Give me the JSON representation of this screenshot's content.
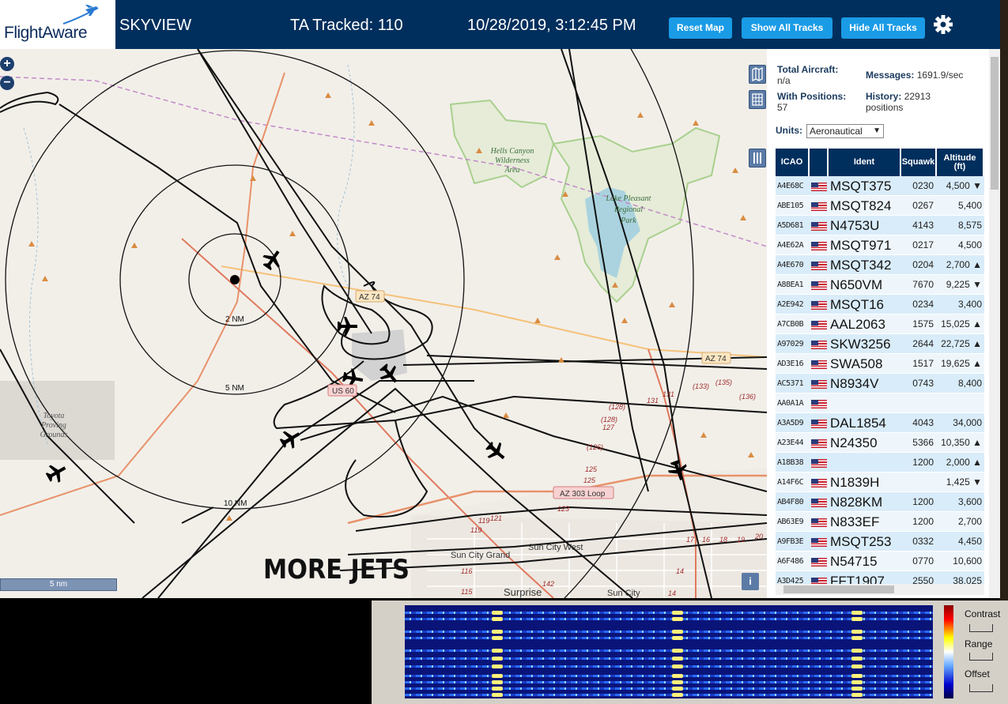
{
  "header": {
    "logo_text": "FlightAware",
    "app_name": "SKYVIEW",
    "tracked": "TA Tracked: 110",
    "datetime": "10/28/2019, 3:12:45 PM",
    "buttons": {
      "reset": "Reset Map",
      "show": "Show All Tracks",
      "hide": "Hide All Tracks"
    }
  },
  "stats": {
    "total_aircraft_label": "Total Aircraft:",
    "total_aircraft_value": "n/a",
    "messages_label": "Messages:",
    "messages_value": "1691.9/sec",
    "with_positions_label": "With Positions:",
    "with_positions_value": "57",
    "history_label": "History:",
    "history_value": "22913",
    "history_unit": "positions",
    "units_label": "Units:",
    "units_value": "Aeronautical"
  },
  "table": {
    "headers": {
      "icao": "ICAO",
      "ident": "Ident",
      "squawk": "Squawk",
      "altitude": "Altitude",
      "alt_unit": "(ft)"
    },
    "rows": [
      {
        "icao": "A4E68C",
        "ident": "MSQT375",
        "squawk": "0230",
        "alt": "4,500 ▼"
      },
      {
        "icao": "ABE105",
        "ident": "MSQT824",
        "squawk": "0267",
        "alt": "5,400"
      },
      {
        "icao": "A5D681",
        "ident": "N4753U",
        "squawk": "4143",
        "alt": "8,575"
      },
      {
        "icao": "A4E62A",
        "ident": "MSQT971",
        "squawk": "0217",
        "alt": "4,500"
      },
      {
        "icao": "A4E670",
        "ident": "MSQT342",
        "squawk": "0204",
        "alt": "2,700 ▲"
      },
      {
        "icao": "A88EA1",
        "ident": "N650VM",
        "squawk": "7670",
        "alt": "9,225 ▼"
      },
      {
        "icao": "A2E942",
        "ident": "MSQT16",
        "squawk": "0234",
        "alt": "3,400"
      },
      {
        "icao": "A7CB0B",
        "ident": "AAL2063",
        "squawk": "1575",
        "alt": "15,025 ▲"
      },
      {
        "icao": "A97029",
        "ident": "SKW3256",
        "squawk": "2644",
        "alt": "22,725 ▲"
      },
      {
        "icao": "AD3E16",
        "ident": "SWA508",
        "squawk": "1517",
        "alt": "19,625 ▲"
      },
      {
        "icao": "AC5371",
        "ident": "N8934V",
        "squawk": "0743",
        "alt": "8,400"
      },
      {
        "icao": "AA0A1A",
        "ident": "",
        "squawk": "",
        "alt": ""
      },
      {
        "icao": "A3A5D9",
        "ident": "DAL1854",
        "squawk": "4043",
        "alt": "34,000"
      },
      {
        "icao": "A23E44",
        "ident": "N24350",
        "squawk": "5366",
        "alt": "10,350 ▲"
      },
      {
        "icao": "A18B38",
        "ident": "",
        "squawk": "1200",
        "alt": "2,000 ▲"
      },
      {
        "icao": "A14F6C",
        "ident": "N1839H",
        "squawk": "",
        "alt": "1,425 ▼"
      },
      {
        "icao": "AB4F80",
        "ident": "N828KM",
        "squawk": "1200",
        "alt": "3,600"
      },
      {
        "icao": "AB63E9",
        "ident": "N833EF",
        "squawk": "1200",
        "alt": "2,700"
      },
      {
        "icao": "A9FB3E",
        "ident": "MSQT253",
        "squawk": "0332",
        "alt": "4,450"
      },
      {
        "icao": "A6F486",
        "ident": "N54715",
        "squawk": "0770",
        "alt": "10,600"
      },
      {
        "icao": "A3D425",
        "ident": "FFT1907",
        "squawk": "2550",
        "alt": "38,025"
      }
    ]
  },
  "map": {
    "range_labels": [
      "2 NM",
      "5 NM",
      "10 NM"
    ],
    "place_labels": {
      "hells_canyon": [
        "Hells Canyon",
        "Wilderness",
        "Area"
      ],
      "lake_pleasant": [
        "Lake Pleasant",
        "Regional",
        "Park"
      ],
      "toyota": [
        "Toyota",
        "Proving",
        "Grounds"
      ],
      "sun_city_grand": "Sun City Grand",
      "sun_city_west": "Sun City West",
      "surprise": "Surprise",
      "sun_city": "Sun City"
    },
    "road_labels": {
      "az74a": "AZ 74",
      "az74b": "AZ 74",
      "us60": "US 60",
      "az303": "AZ 303 Loop"
    },
    "exit_numbers": [
      "131",
      "131",
      "(133)",
      "(135)",
      "(136)",
      "(128)",
      "(128)",
      "127",
      "(126)",
      "125",
      "125",
      "123",
      "121",
      "119",
      "119",
      "116",
      "115",
      "142",
      "14",
      "17",
      "16",
      "18",
      "19",
      "20",
      "14"
    ],
    "overlay_text": "MORE JETS",
    "scale_label": "5 nm",
    "info_label": "i",
    "zoom_in": "+",
    "zoom_out": "−"
  },
  "waterfall": {
    "labels": {
      "contrast": "Contrast",
      "range": "Range",
      "offset": "Offset"
    }
  }
}
